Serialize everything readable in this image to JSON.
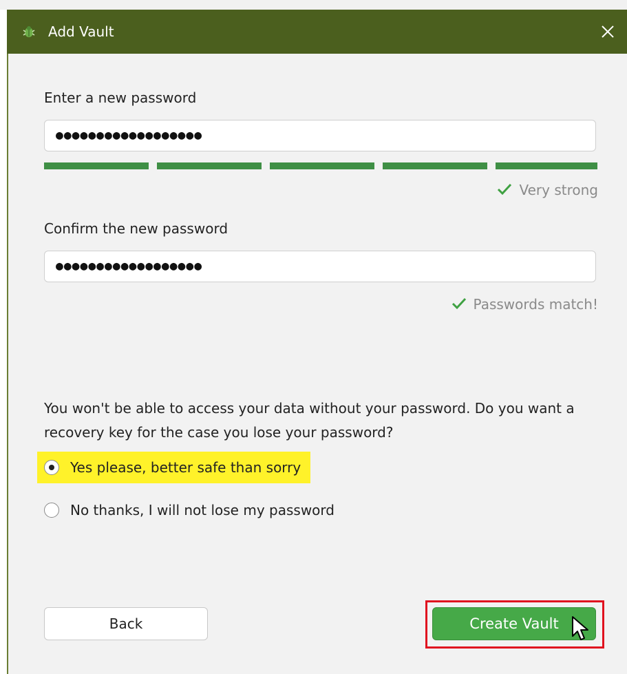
{
  "window": {
    "title": "Add Vault",
    "title_bar_color": "#4b5f1e",
    "app_icon": "vault-bug-icon",
    "close_icon": "close-icon"
  },
  "new_password": {
    "label": "Enter a new password",
    "value": "●●●●●●●●●●●●●●●●●●",
    "strength_segments_filled": 5,
    "strength_segments_total": 5,
    "strength_text": "Very strong",
    "strength_color": "#3f8f45"
  },
  "confirm_password": {
    "label": "Confirm the new password",
    "value": "●●●●●●●●●●●●●●●●●●",
    "match_text": "Passwords match!"
  },
  "recovery": {
    "question": "You won't be able to access your data without your password. Do you want a recovery key for the case you lose your password?",
    "options": [
      {
        "label": "Yes please, better safe than sorry",
        "selected": true,
        "highlighted": true
      },
      {
        "label": "No thanks, I will not lose my password",
        "selected": false,
        "highlighted": false
      }
    ]
  },
  "buttons": {
    "back": "Back",
    "create": "Create Vault",
    "create_color": "#46a948",
    "highlight_outline_color": "#e0121f"
  }
}
